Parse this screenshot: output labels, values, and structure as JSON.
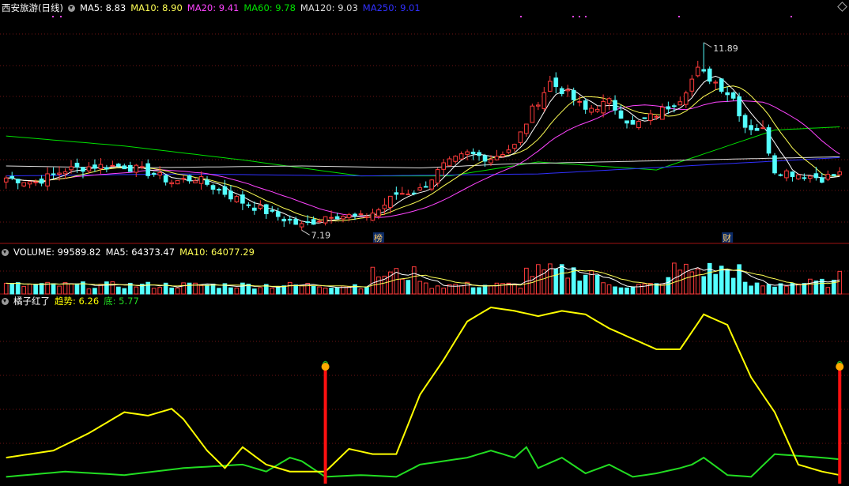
{
  "colors": {
    "background": "#000000",
    "frame": "#a11212",
    "grid": "#6e1515",
    "up": "#ff3b3b",
    "down": "#54ffff",
    "ma5": "#ffffff",
    "ma10": "#ffff55",
    "ma20": "#ff44ff",
    "ma60": "#00e000",
    "ma120": "#dddddd",
    "ma250": "#3030ff",
    "trend": "#ffff00",
    "bottom": "#22dd22",
    "signal": "#ff1010"
  },
  "main_header": {
    "stock": "西安旅游(日线)",
    "ma5": "MA5: 8.83",
    "ma10": "MA10: 8.90",
    "ma20": "MA20: 9.41",
    "ma60": "MA60: 9.78",
    "ma120": "MA120: 9.03",
    "ma250": "MA250: 9.01"
  },
  "volume_header": {
    "volume": "VOLUME: 99589.82",
    "ma5": "MA5: 64373.47",
    "ma10": "MA10: 64077.29"
  },
  "indicator_header": {
    "name": "橘子红了",
    "trend": "趋势: 6.26",
    "bottom": "底: 5.77"
  },
  "chart_data": [
    {
      "type": "candlestick",
      "ylim": [
        6.9,
        12.6
      ],
      "annotations": [
        {
          "text": "11.89",
          "at": "high",
          "index": 118,
          "value": 11.89
        },
        {
          "text": "7.19",
          "at": "low",
          "index": 50,
          "value": 7.19
        },
        {
          "text": "榜",
          "index": 63
        },
        {
          "text": "财",
          "index": 122
        }
      ],
      "ohlc_anchors": [
        {
          "i": 0,
          "c": 8.5
        },
        {
          "i": 5,
          "c": 8.4
        },
        {
          "i": 10,
          "c": 8.7
        },
        {
          "i": 15,
          "c": 8.8
        },
        {
          "i": 20,
          "c": 8.8
        },
        {
          "i": 25,
          "c": 8.6
        },
        {
          "i": 28,
          "c": 8.4
        },
        {
          "i": 32,
          "c": 8.5
        },
        {
          "i": 36,
          "c": 8.2
        },
        {
          "i": 40,
          "c": 7.9
        },
        {
          "i": 45,
          "c": 7.6
        },
        {
          "i": 50,
          "c": 7.3
        },
        {
          "i": 55,
          "c": 7.6
        },
        {
          "i": 60,
          "c": 7.5
        },
        {
          "i": 63,
          "c": 7.7
        },
        {
          "i": 66,
          "c": 8.1
        },
        {
          "i": 70,
          "c": 8.2
        },
        {
          "i": 74,
          "c": 8.8
        },
        {
          "i": 78,
          "c": 9.1
        },
        {
          "i": 82,
          "c": 9.0
        },
        {
          "i": 86,
          "c": 9.3
        },
        {
          "i": 89,
          "c": 10.2
        },
        {
          "i": 92,
          "c": 10.9
        },
        {
          "i": 95,
          "c": 10.6
        },
        {
          "i": 98,
          "c": 10.2
        },
        {
          "i": 102,
          "c": 10.4
        },
        {
          "i": 106,
          "c": 9.8
        },
        {
          "i": 110,
          "c": 10.1
        },
        {
          "i": 114,
          "c": 10.5
        },
        {
          "i": 117,
          "c": 11.2
        },
        {
          "i": 120,
          "c": 10.9
        },
        {
          "i": 123,
          "c": 10.5
        },
        {
          "i": 125,
          "c": 9.8
        },
        {
          "i": 128,
          "c": 9.7
        },
        {
          "i": 130,
          "c": 8.7
        },
        {
          "i": 134,
          "c": 8.6
        },
        {
          "i": 138,
          "c": 8.5
        },
        {
          "i": 141,
          "c": 8.6
        }
      ],
      "ma_series": [
        {
          "name": "MA60",
          "values_at": [
            [
              0,
              9.55
            ],
            [
              20,
              9.3
            ],
            [
              40,
              8.95
            ],
            [
              60,
              8.55
            ],
            [
              75,
              8.55
            ],
            [
              90,
              8.9
            ],
            [
              100,
              8.8
            ],
            [
              110,
              8.7
            ],
            [
              118,
              9.1
            ],
            [
              130,
              9.7
            ],
            [
              141,
              9.78
            ]
          ]
        },
        {
          "name": "MA120",
          "values_at": [
            [
              0,
              8.8
            ],
            [
              20,
              8.75
            ],
            [
              50,
              8.8
            ],
            [
              70,
              8.75
            ],
            [
              85,
              8.85
            ],
            [
              141,
              9.03
            ]
          ]
        },
        {
          "name": "MA250",
          "values_at": [
            [
              0,
              8.55
            ],
            [
              30,
              8.6
            ],
            [
              60,
              8.55
            ],
            [
              90,
              8.6
            ],
            [
              141,
              9.01
            ]
          ]
        }
      ]
    },
    {
      "type": "bar",
      "name": "VOLUME",
      "ylim": [
        0,
        160000
      ],
      "last_value": 99589.82
    },
    {
      "type": "line",
      "series": [
        {
          "name": "趋势",
          "last": 6.26
        },
        {
          "name": "底",
          "last": 5.77
        }
      ],
      "signals": [
        54,
        141
      ],
      "ylim": [
        0,
        100
      ]
    }
  ]
}
